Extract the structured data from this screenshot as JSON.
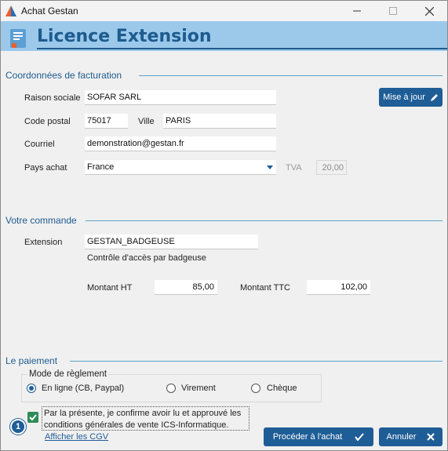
{
  "window": {
    "title": "Achat Gestan"
  },
  "header": {
    "title": "Licence Extension"
  },
  "billing": {
    "section_title": "Coordonnées de facturation",
    "raison_label": "Raison sociale",
    "raison_value": "SOFAR SARL",
    "cp_label": "Code postal",
    "cp_value": "75017",
    "ville_label": "Ville",
    "ville_value": "PARIS",
    "email_label": "Courriel",
    "email_value": "demonstration@gestan.fr",
    "pays_label": "Pays achat",
    "pays_value": "France",
    "tva_label": "TVA",
    "tva_value": "20,00",
    "update_label": "Mise à jour"
  },
  "order": {
    "section_title": "Votre commande",
    "ext_label": "Extension",
    "ext_value": "GESTAN_BADGEUSE",
    "ext_desc": "Contrôle d'accès par badgeuse",
    "ht_label": "Montant HT",
    "ht_value": "85,00",
    "ttc_label": "Montant TTC",
    "ttc_value": "102,00"
  },
  "payment": {
    "section_title": "Le paiement",
    "mode_label": "Mode de règlement",
    "options": [
      "En ligne (CB, Paypal)",
      "Virement",
      "Chèque"
    ],
    "selected": "En ligne (CB, Paypal)",
    "confirm_line1": "Par la présente, je confirme avoir lu et approuvé les",
    "confirm_line2": "conditions générales de vente ICS-Informatique.",
    "confirm_checked": true,
    "step_badge": "1",
    "cgv_link": "Afficher les CGV"
  },
  "actions": {
    "purchase_label": "Procéder à l'achat",
    "cancel_label": "Annuler"
  },
  "colors": {
    "accent": "#1f5d96",
    "header_bg": "#9cc9ea",
    "section_title": "#1d5b8f",
    "check_green": "#2e8b57"
  }
}
